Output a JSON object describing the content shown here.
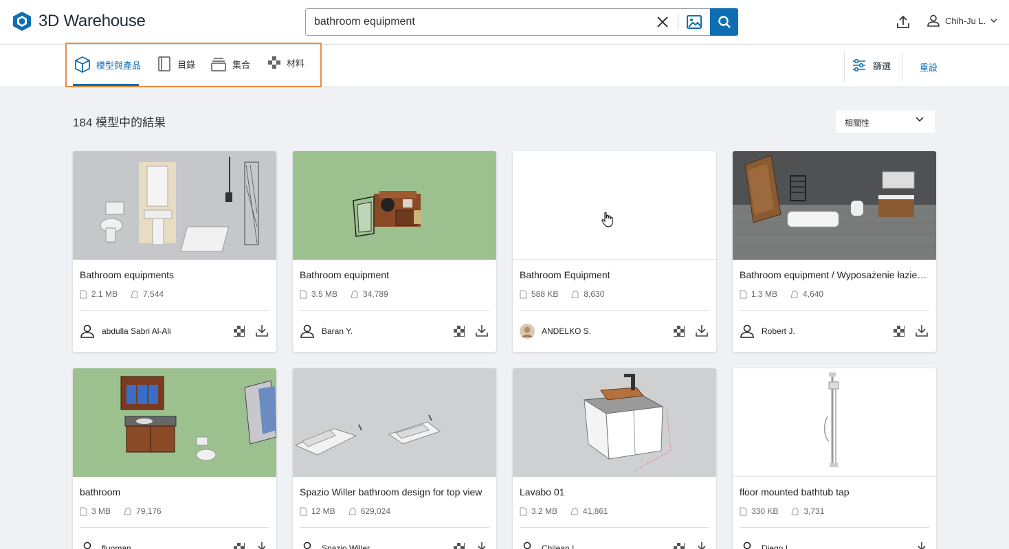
{
  "header": {
    "logo_text": "3D Warehouse",
    "search_value": "bathroom equipment",
    "user_name": "Chih-Ju L."
  },
  "tabs": [
    {
      "label": "模型與產品",
      "icon": "cube-icon",
      "active": true
    },
    {
      "label": "目錄",
      "icon": "catalog-icon",
      "active": false
    },
    {
      "label": "集合",
      "icon": "collection-icon",
      "active": false
    },
    {
      "label": "材料",
      "icon": "material-icon",
      "active": false
    }
  ],
  "filter_label": "篩選",
  "reset_label": "重設",
  "results_text": "184 模型中的結果",
  "sort_label": "相關性",
  "colors": {
    "accent": "#0f6eb3",
    "highlight": "#ee8a3c"
  },
  "cards": [
    {
      "title": "Bathroom equipments",
      "size": "2.1 MB",
      "likes": "7,544",
      "author": "abdulla Sabri Al-Ali",
      "has_material": true
    },
    {
      "title": "Bathroom equipment",
      "size": "3.5 MB",
      "likes": "34,789",
      "author": "Baran Y.",
      "has_material": true
    },
    {
      "title": "Bathroom Equipment",
      "size": "588 KB",
      "likes": "8,630",
      "author": "ANDELKO S.",
      "has_material": true
    },
    {
      "title": "Bathroom equipment / Wyposażenie łazienki",
      "size": "1.3 MB",
      "likes": "4,640",
      "author": "Robert J.",
      "has_material": true
    },
    {
      "title": "bathroom",
      "size": "3 MB",
      "likes": "79,176",
      "author": "fluoman",
      "has_material": true
    },
    {
      "title": "Spazio Willer bathroom design for top view",
      "size": "12 MB",
      "likes": "629,024",
      "author": "Spazio Willer",
      "has_material": true
    },
    {
      "title": "Lavabo 01",
      "size": "3.2 MB",
      "likes": "41,861",
      "author": "Chilean I.",
      "has_material": true
    },
    {
      "title": "floor mounted bathtub tap",
      "size": "330 KB",
      "likes": "3,731",
      "author": "Diego L.",
      "has_material": false
    }
  ]
}
